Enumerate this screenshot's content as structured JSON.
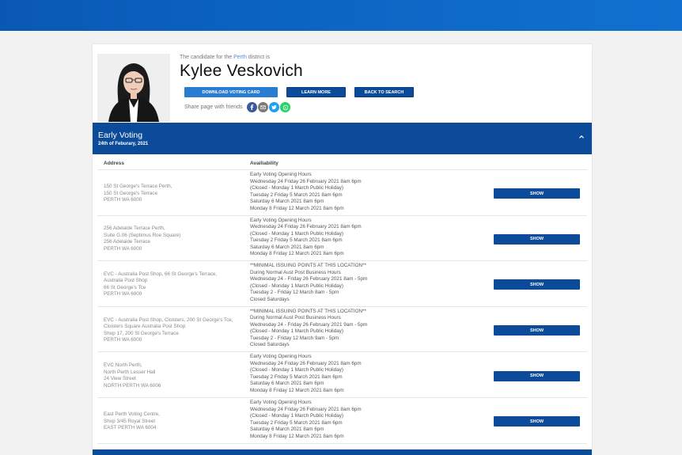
{
  "candidate": {
    "intro_prefix": "The candidate for the",
    "district": "Perth",
    "intro_suffix": "district is",
    "name": "Kylee Veskovich"
  },
  "actions": {
    "download_label": "DOWNLOAD VOTING CARD",
    "learn_label": "LEARN MORE",
    "back_label": "BACK TO SEARCH",
    "share_label": "Share page with friends"
  },
  "social": [
    "facebook-icon",
    "email-icon",
    "twitter-icon",
    "whatsapp-icon"
  ],
  "section": {
    "title": "Early Voting",
    "date": "24th of Feburary, 2021"
  },
  "table": {
    "headers": {
      "address": "Address",
      "availability": "Availiability"
    },
    "show_label": "SHOW",
    "rows": [
      {
        "address": [
          "150 St George's Terrace Perth,",
          "150 St George's Terrace",
          "PERTH WA 6000"
        ],
        "availability": [
          "Early Voting Opening Hours",
          "Wednesday 24 Friday 26 February 2021 8am 6pm",
          "(Closed - Monday 1 March Public Holiday)",
          "Tuesday 2 Friday 5 March 2021 8am 6pm",
          "Saturday 6 March 2021 8am 6pm",
          "Monday 8 Friday 12 March 2021 8am 6pm"
        ]
      },
      {
        "address": [
          "256 Adelaide Terrace Perth,",
          "Suite G.06 (Septimus Roe Square)",
          "256 Adelaide Terrace",
          "PERTH WA 6000"
        ],
        "availability": [
          "Early Voting Opening Hours",
          "Wednesday 24 Friday 26 February 2021 8am 6pm",
          "(Closed - Monday 1 March Public Holiday)",
          "Tuesday 2 Friday 5 March 2021 8am 6pm",
          "Saturday 6 March 2021 8am 6pm",
          "Monday 8 Friday 12 March 2021 8am 6pm"
        ]
      },
      {
        "address": [
          "EVC - Australia Post Shop, 66 St George's Terrace,",
          "Australia Post Shop",
          "66 St George's Tce",
          "PERTH WA 6000"
        ],
        "availability": [
          "**MINIMAL ISSUING POINTS AT THIS LOCATION**",
          "During Normal Aust Post Business Hours",
          "Wednesday 24 - Friday 26 February 2021 8am - 5pm",
          "(Closed - Monday 1 March Public Holiday)",
          "Tuesday 2 - Friday 12 March 8am - 5pm",
          "Closed Saturdays"
        ]
      },
      {
        "address": [
          "EVC - Australia Post Shop, Cloisters, 200 St George's Tce,",
          "Cloisters Square Australia Post Shop",
          "Shop 17, 200 St George's Terrace",
          "PERTH WA 6000"
        ],
        "availability": [
          "**MINIMAL ISSUING POINTS AT THIS LOCATION**",
          "During Normal Aust Post Business Hours",
          "Wednesday 24 - Friday 26 February 2021 9am - 5pm",
          "(Closed - Monday 1 March Public Holiday)",
          "Tuesday 2 - Friday 12 March 9am - 5pm",
          "Closed Saturdays"
        ]
      },
      {
        "address": [
          "EVC North Perth,",
          "North Perth Lesser Hall",
          "24 View Street",
          "NORTH PERTH WA 6006"
        ],
        "availability": [
          "Early Voting Opening Hours",
          "Wednesday 24 Friday 26 February 2021 8am 6pm",
          "(Closed - Monday 1 March Public Holiday)",
          "Tuesday 2 Friday 5 March 2021 8am 6pm",
          "Saturday 6 March 2021 8am 6pm",
          "Monday 8 Friday 12 March 2021 8am 6pm"
        ]
      },
      {
        "address": [
          "East Perth Voting Centre,",
          "Shop 3/45 Royal Street",
          "EAST PERTH WA 6004"
        ],
        "availability": [
          "Early Voting Opening Hours",
          "Wednesday 24 Friday 26 February 2021 8am 6pm",
          "(Closed - Monday 1 March Public Holiday)",
          "Tuesday 2 Friday 5 March 2021 8am 6pm",
          "Saturday 6 March 2021 8am 6pm",
          "Monday 8 Friday 12 March 2021 8am 6pm"
        ]
      }
    ]
  }
}
